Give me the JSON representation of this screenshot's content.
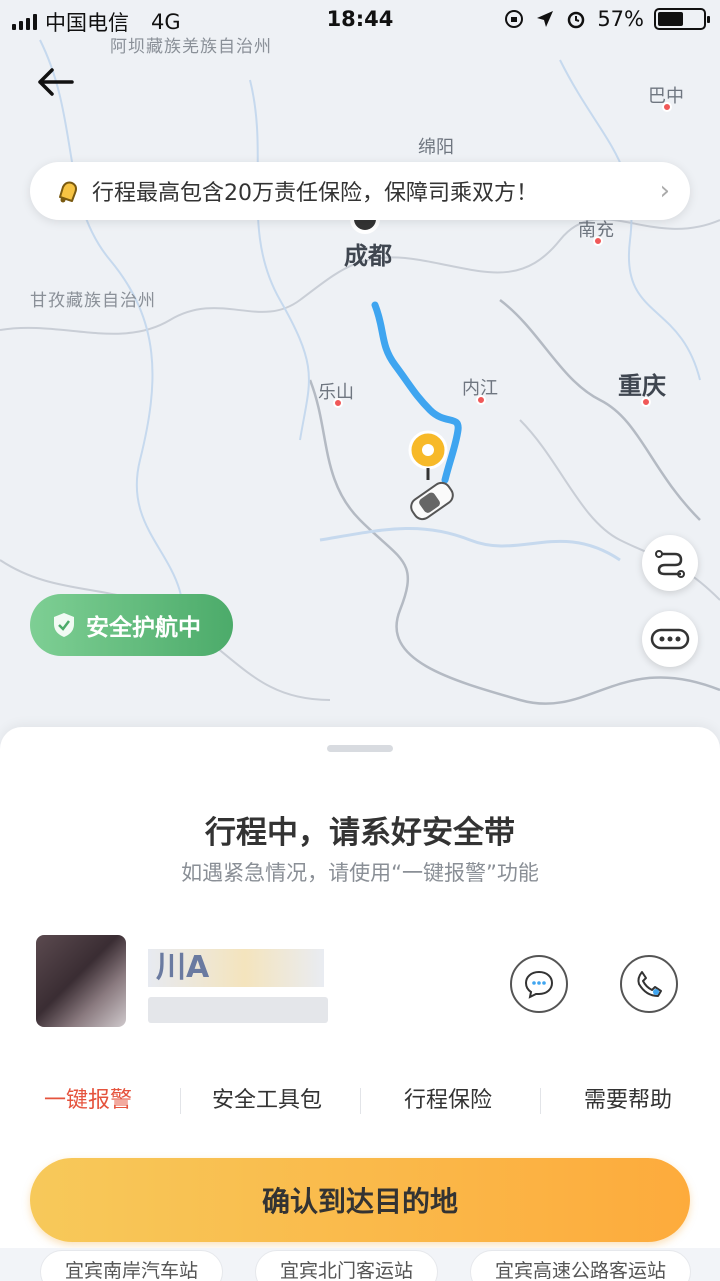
{
  "status_bar": {
    "carrier": "中国电信",
    "network": "4G",
    "time": "18:44",
    "battery": "57%",
    "battery_level": 0.57
  },
  "map": {
    "labels": {
      "aba": "阿坝藏族羌族自治州",
      "bazhong": "巴中",
      "mianyang": "绵阳",
      "nanchong": "南充",
      "chengdu": "成都",
      "ganzi": "甘孜藏族自治州",
      "leshan": "乐山",
      "neijiang": "内江",
      "chongqing": "重庆"
    },
    "route_color": "#3fa5f0"
  },
  "banner": {
    "icon": "bell-icon",
    "text": "行程最高包含20万责任保险，保障司乘双方！"
  },
  "safe_badge": {
    "icon": "shield-icon",
    "label": "安全护航中"
  },
  "panel": {
    "title": "行程中，请系好安全带",
    "subtitle": "如遇紧急情况，请使用“一键报警”功能",
    "driver": {
      "plate": "川A"
    },
    "tools": [
      {
        "label": "一键报警"
      },
      {
        "label": "安全工具包"
      },
      {
        "label": "行程保险"
      },
      {
        "label": "需要帮助"
      }
    ],
    "confirm_label": "确认到达目的地",
    "destinations": [
      "宜宾南岸汽车站",
      "宜宾北门客运站",
      "宜宾高速公路客运站"
    ]
  },
  "colors": {
    "accent": "#fdab3c",
    "alert": "#e5533d",
    "safe_green": "#4cab6a"
  }
}
